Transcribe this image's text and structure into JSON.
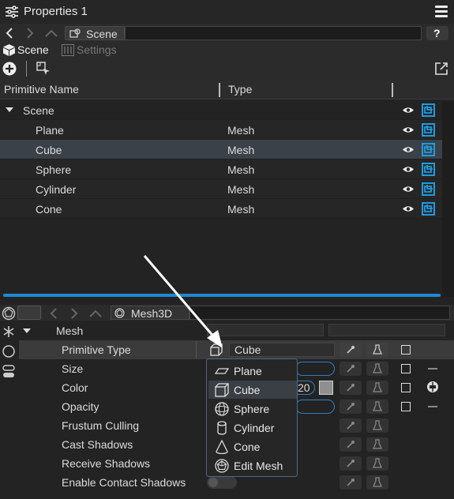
{
  "window": {
    "title": "Properties 1"
  },
  "nav": {
    "breadcrumb": "Scene",
    "help": "?"
  },
  "tabs": [
    {
      "label": "Scene"
    },
    {
      "label": "Settings"
    }
  ],
  "table": {
    "headers": {
      "name": "Primitive Name",
      "type": "Type"
    },
    "root": "Scene",
    "rows": [
      {
        "name": "Plane",
        "type": "Mesh"
      },
      {
        "name": "Cube",
        "type": "Mesh"
      },
      {
        "name": "Sphere",
        "type": "Mesh"
      },
      {
        "name": "Cylinder",
        "type": "Mesh"
      },
      {
        "name": "Cone",
        "type": "Mesh"
      }
    ]
  },
  "lower": {
    "breadcrumb": "Mesh3D",
    "section": "Mesh",
    "primitive_type_value": "Cube",
    "color_value_fragment": "20",
    "properties": [
      "Primitive Type",
      "Size",
      "Color",
      "Opacity",
      "Frustum Culling",
      "Cast Shadows",
      "Receive Shadows",
      "Enable Contact Shadows"
    ]
  },
  "dropdown": {
    "items": [
      {
        "label": "Plane",
        "icon": "plane-icon"
      },
      {
        "label": "Cube",
        "icon": "cube-icon"
      },
      {
        "label": "Sphere",
        "icon": "sphere-icon"
      },
      {
        "label": "Cylinder",
        "icon": "cylinder-icon"
      },
      {
        "label": "Cone",
        "icon": "cone-icon"
      },
      {
        "label": "Edit Mesh",
        "icon": "edit-mesh-icon"
      }
    ],
    "selected": "Cube"
  },
  "colors": {
    "accent": "#1e88d6",
    "selected_row": "#3a4148",
    "background": "#232323"
  }
}
